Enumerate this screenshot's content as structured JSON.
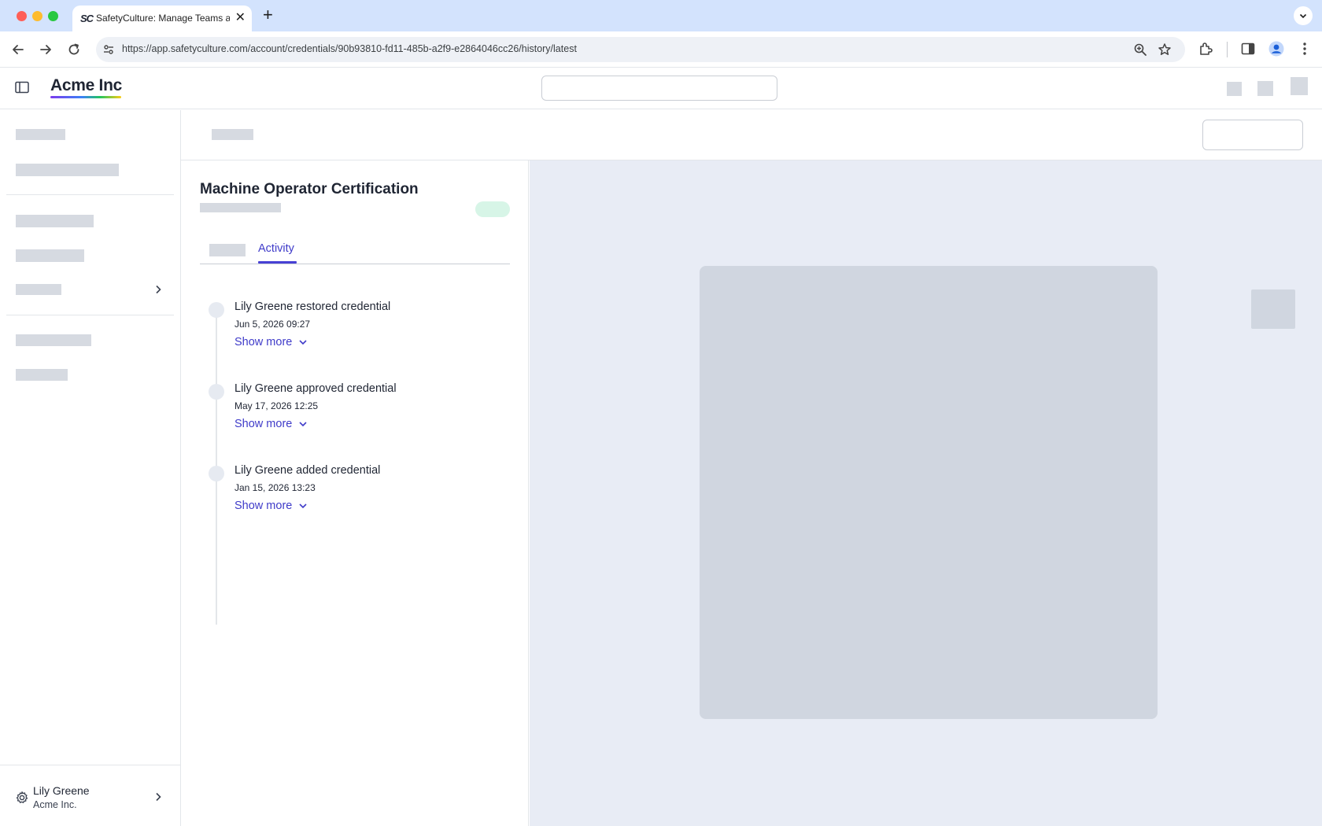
{
  "browser": {
    "tab_favicon": "SC",
    "tab_title": "SafetyCulture: Manage Teams and...",
    "tab_close_glyph": "✕",
    "new_tab_glyph": "+",
    "url": "https://app.safetyculture.com/account/credentials/90b93810-fd11-485b-a2f9-e2864046cc26/history/latest"
  },
  "header": {
    "logo_text": "Acme Inc"
  },
  "detail": {
    "title": "Machine Operator Certification",
    "active_tab": "Activity",
    "activity": [
      {
        "title": "Lily Greene restored credential",
        "date": "Jun 5, 2026 09:27",
        "more": "Show more"
      },
      {
        "title": "Lily Greene approved credential",
        "date": "May 17, 2026 12:25",
        "more": "Show more"
      },
      {
        "title": "Lily Greene added credential",
        "date": "Jan 15, 2026 13:23",
        "more": "Show more"
      }
    ]
  },
  "sidebar": {
    "user": {
      "name": "Lily Greene",
      "org": "Acme Inc."
    }
  },
  "colors": {
    "accent": "#4740d4",
    "status_pill": "#d7f5e7",
    "preview_bg": "#e8ecf5",
    "placeholder": "#d6dae1"
  }
}
